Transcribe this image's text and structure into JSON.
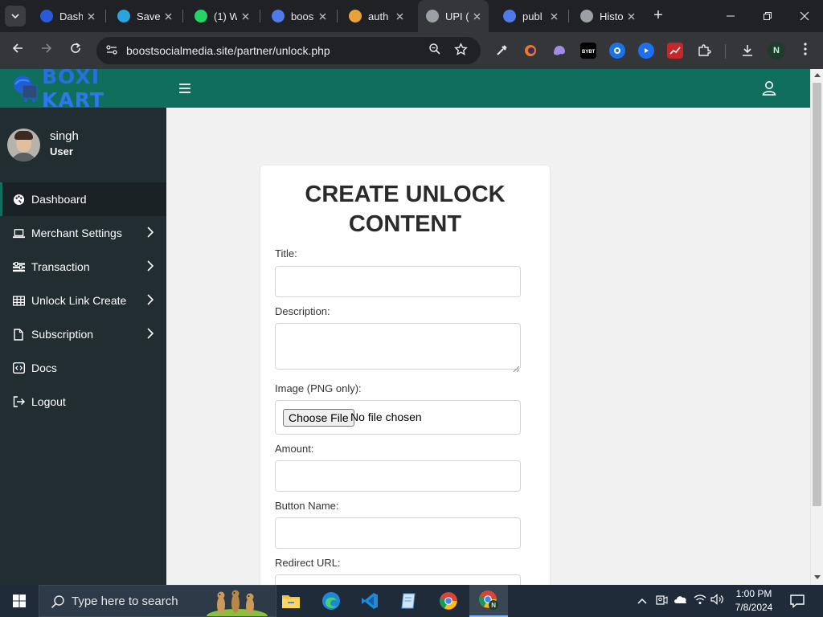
{
  "browser": {
    "tabs": [
      {
        "label": "Dash",
        "favicon": "dashboard-favicon",
        "color": "#2b5ad6"
      },
      {
        "label": "Save",
        "favicon": "telegram-favicon",
        "color": "#2aa3de"
      },
      {
        "label": "(1) W",
        "favicon": "whatsapp-favicon",
        "color": "#25d366"
      },
      {
        "label": "boos",
        "favicon": "site-favicon",
        "color": "#4f7ae8"
      },
      {
        "label": "auth",
        "favicon": "warning-favicon",
        "color": "#e8a23a"
      },
      {
        "label": "UPI (",
        "favicon": "globe-favicon",
        "color": "#9aa0a6"
      },
      {
        "label": "publ",
        "favicon": "site-favicon",
        "color": "#4f7ae8"
      },
      {
        "label": "Histo",
        "favicon": "history-favicon",
        "color": "#9aa0a6"
      }
    ],
    "active_tab_index": 5,
    "url": "boostsocialmedia.site/partner/unlock.php",
    "profile_initial": "N"
  },
  "app": {
    "brand": "BOXI KART",
    "brand_color": "#1e5fd6",
    "theme_color": "#0f6e5c",
    "user": {
      "name": "singh",
      "role": "User"
    },
    "menu": [
      {
        "label": "Dashboard",
        "icon": "palette-icon",
        "active": true,
        "has_submenu": false
      },
      {
        "label": "Merchant Settings",
        "icon": "laptop-icon",
        "active": false,
        "has_submenu": true
      },
      {
        "label": "Transaction",
        "icon": "sliders-icon",
        "active": false,
        "has_submenu": true
      },
      {
        "label": "Unlock Link Create",
        "icon": "table-icon",
        "active": false,
        "has_submenu": true
      },
      {
        "label": "Subscription",
        "icon": "file-icon",
        "active": false,
        "has_submenu": true
      },
      {
        "label": "Docs",
        "icon": "code-icon",
        "active": false,
        "has_submenu": false
      },
      {
        "label": "Logout",
        "icon": "logout-icon",
        "active": false,
        "has_submenu": false
      }
    ]
  },
  "form": {
    "title": "CREATE UNLOCK CONTENT",
    "title_value": "",
    "title_label": "Title:",
    "description_label": "Description:",
    "description_value": "",
    "image_label": "Image (PNG only):",
    "file_button": "Choose File",
    "file_status": "No file chosen",
    "amount_label": "Amount:",
    "amount_value": "",
    "button_name_label": "Button Name:",
    "button_name_value": "",
    "redirect_url_label": "Redirect URL:",
    "redirect_url_value": ""
  },
  "taskbar": {
    "search_placeholder": "Type here to search",
    "apps": [
      "file-explorer",
      "edge",
      "vscode",
      "notepad",
      "chrome",
      "chrome-profile"
    ],
    "time": "1:00 PM",
    "date": "7/8/2024"
  }
}
